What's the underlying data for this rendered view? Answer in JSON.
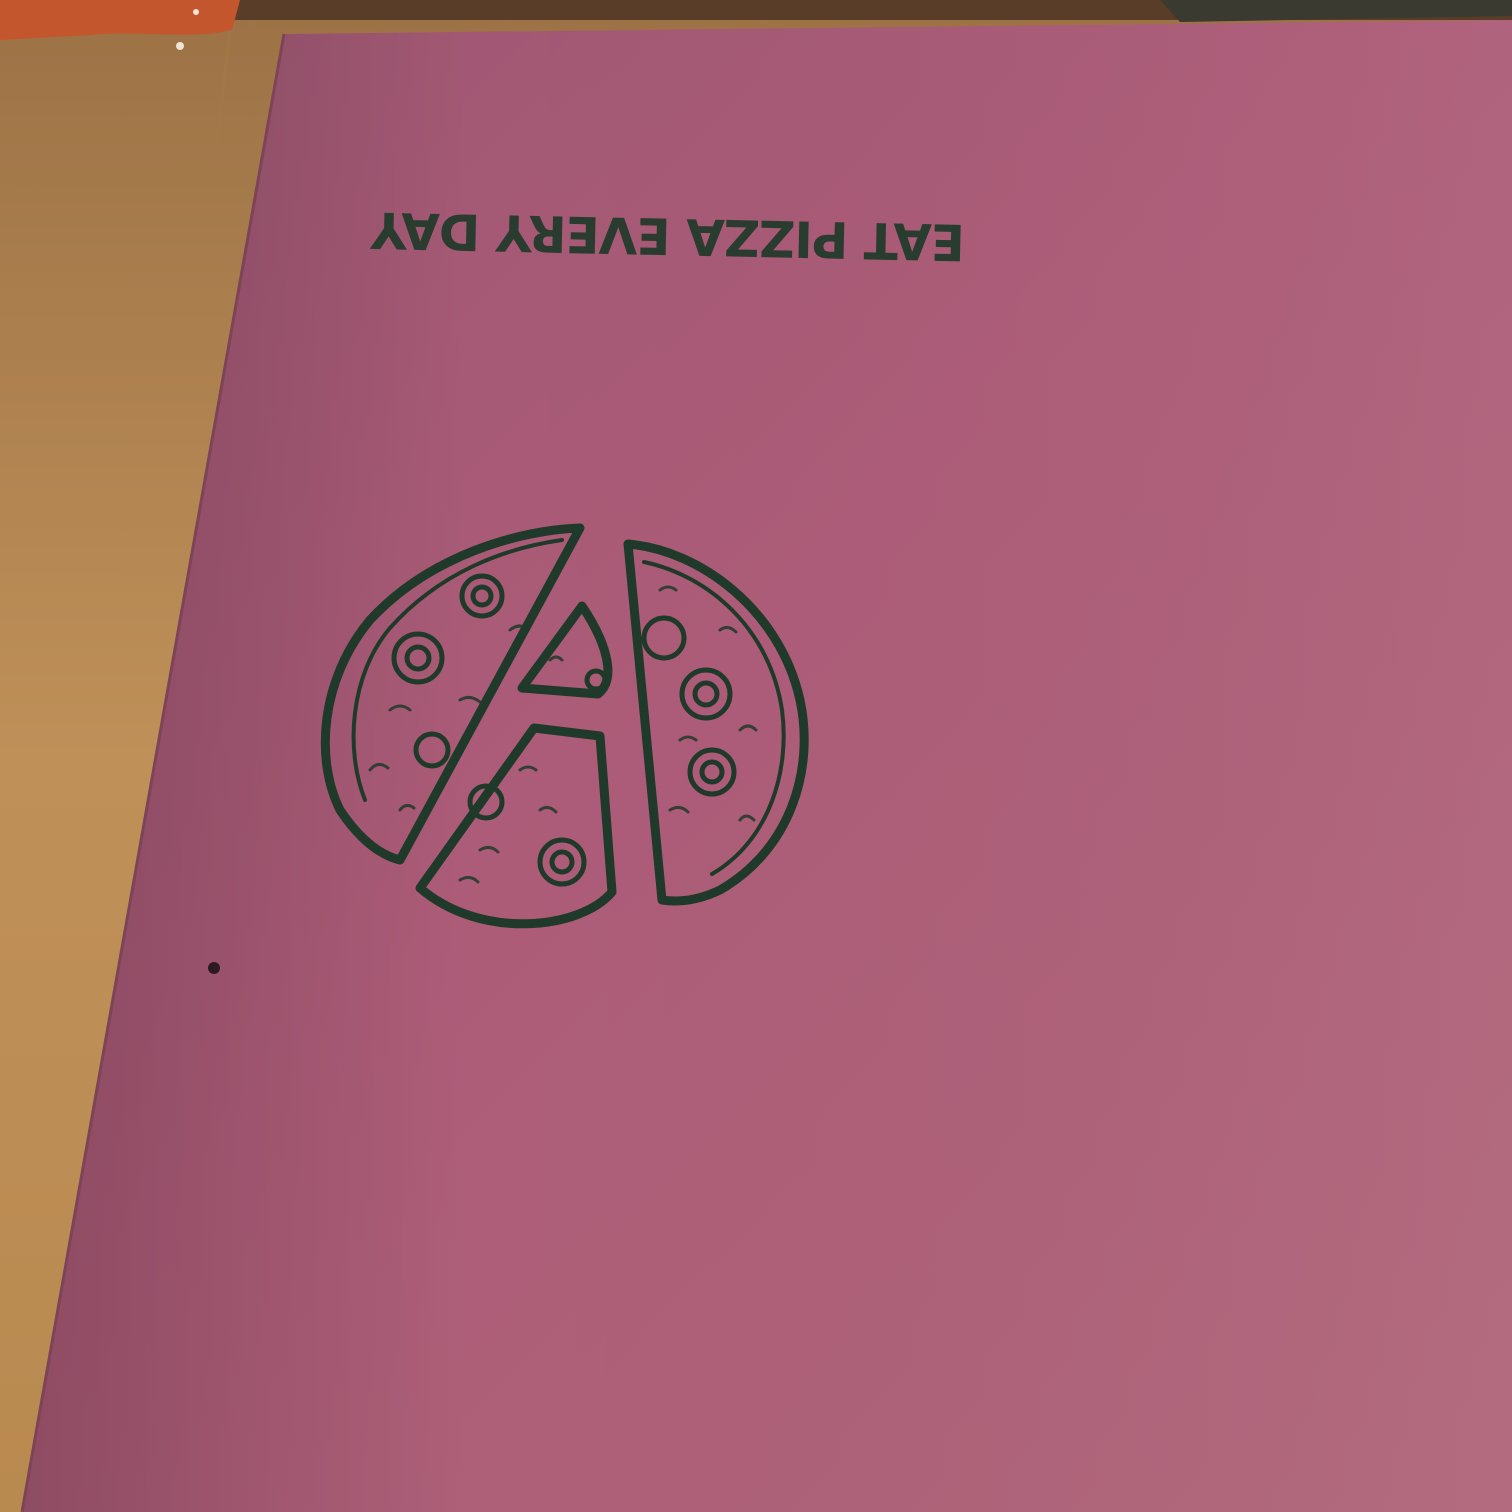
{
  "photo": {
    "subject": "",
    "box_color": "#a85a72",
    "table_color": "#b88a52",
    "ink_color": "#1f3a2a"
  },
  "box_print": {
    "slogan": "EAT PIZZA EVERY DAY",
    "illustration_icon": "pizza-slices-icon"
  }
}
